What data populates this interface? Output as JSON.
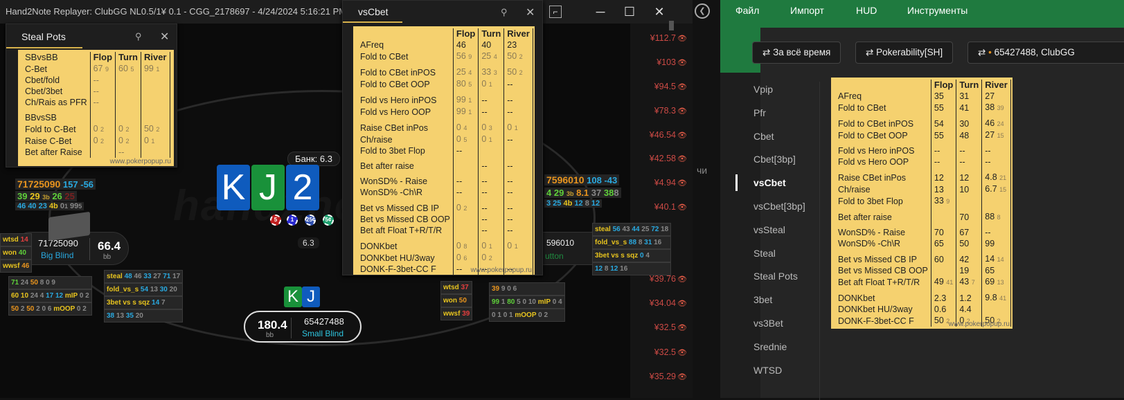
{
  "replayer": {
    "title": "Hand2Note Replayer: ClubGG NL0.5/1¥ 0.1 - CGG_2178697 - 4/24/2024 5:16:21 PM - 6",
    "pot_label": "Банк: 6.3",
    "pot_amount": "6.3",
    "watermark": "hand2note",
    "board": [
      "K",
      "J",
      "2"
    ],
    "hero_cards": [
      "K",
      "J"
    ],
    "chips": [
      "5",
      "1",
      "25¢",
      "5¢"
    ],
    "side_text": "чи",
    "amounts": [
      "¥112.7",
      "¥103",
      "¥94.5",
      "¥78.3",
      "¥46.54",
      "¥42.58",
      "¥4.94",
      "¥40.1",
      "¥39.76",
      "¥34.04",
      "¥32.5",
      "¥32.5",
      "¥35.29"
    ],
    "seat_bb": {
      "name": "71725090",
      "pos": "Big Blind",
      "stack": "66.4",
      "unit": "bb"
    },
    "seat_sb": {
      "name": "65427488",
      "pos": "Small Blind",
      "stack": "180.4",
      "unit": "bb"
    },
    "seat_btn": {
      "name": "596010",
      "pos": "utton"
    },
    "hud_bb": {
      "line1": [
        "71725090",
        "157",
        "-56"
      ],
      "line2": [
        "39",
        "29",
        "3b",
        "26",
        "25"
      ],
      "line3": [
        "46",
        "40",
        "23",
        "4b",
        "0",
        "1",
        "99",
        "5"
      ],
      "side": [
        [
          "wtsd",
          "14"
        ],
        [
          "won",
          "40"
        ],
        [
          "wwsf",
          "46"
        ]
      ],
      "stats1": [
        "71",
        "24",
        "50",
        "8",
        "0",
        "9"
      ],
      "stats2": [
        "60",
        "10",
        "24",
        "4",
        "17",
        "12",
        "mIP",
        "0",
        "2"
      ],
      "stats3": [
        "50",
        "2",
        "50",
        "2",
        "0",
        "6",
        "mOOP",
        "0",
        "2"
      ],
      "steal": [
        "steal",
        "48",
        "46",
        "33",
        "27",
        "71",
        "17"
      ],
      "fold": [
        "fold_vs_s",
        "54",
        "13",
        "30",
        "20"
      ],
      "tbet": [
        "3bet vs s",
        "sqz",
        "14",
        "7"
      ],
      "last": [
        "38",
        "13",
        "35",
        "20"
      ]
    },
    "hud_btn": {
      "line1": [
        "7596010",
        "108",
        "-43"
      ],
      "line2": [
        "4",
        "29",
        "3b",
        "8.1",
        "37",
        "38",
        "8"
      ],
      "line3": [
        "3",
        "25",
        "4b",
        "12",
        "8",
        "12"
      ],
      "steal": [
        "steal",
        "56",
        "43",
        "44",
        "25",
        "72",
        "18"
      ],
      "fold": [
        "fold_vs_s",
        "88",
        "8",
        "31",
        "16"
      ],
      "tbet": [
        "3bet vs s",
        "sqz",
        "0",
        "4"
      ],
      "last": [
        "12",
        "8",
        "12",
        "16"
      ],
      "side": [
        [
          "wtsd",
          "37"
        ],
        [
          "won",
          "50"
        ],
        [
          "wwsf",
          "39"
        ]
      ],
      "stats1": [
        "39",
        "9",
        "0",
        "6"
      ],
      "stats2": [
        "99",
        "1",
        "80",
        "5",
        "0",
        "10",
        "mIP",
        "0",
        "4"
      ],
      "stats3": [
        "0",
        "1",
        "0",
        "1",
        "mOOP",
        "0",
        "2"
      ]
    }
  },
  "steal_pots": {
    "title": "Steal Pots",
    "headers": [
      "SBvsBB",
      "Flop",
      "Turn",
      "River"
    ],
    "rows1": [
      {
        "label": "C-Bet",
        "flop": "67",
        "flop_n": "9",
        "turn": "60",
        "turn_n": "5",
        "river": "99",
        "river_n": "1"
      },
      {
        "label": "Cbet/fold",
        "flop": "--",
        "flop_n": "",
        "turn": "",
        "turn_n": "",
        "river": "",
        "river_n": ""
      },
      {
        "label": "Cbet/3bet",
        "flop": "--",
        "flop_n": "",
        "turn": "",
        "turn_n": "",
        "river": "",
        "river_n": ""
      },
      {
        "label": "Ch/Rais as PFR",
        "flop": "--",
        "flop_n": "",
        "turn": "",
        "turn_n": "",
        "river": "",
        "river_n": ""
      }
    ],
    "header2": "BBvsSB",
    "rows2": [
      {
        "label": "Fold to C-Bet",
        "flop": "0",
        "flop_n": "2",
        "turn": "0",
        "turn_n": "2",
        "river": "50",
        "river_n": "2"
      },
      {
        "label": "Raise C-Bet",
        "flop": "0",
        "flop_n": "2",
        "turn": "0",
        "turn_n": "2",
        "river": "0",
        "river_n": "1"
      },
      {
        "label": "Bet after Raise",
        "flop": "",
        "flop_n": "",
        "turn": "--",
        "turn_n": "",
        "river": "",
        "river_n": ""
      }
    ],
    "footer": "www.pokerpopup.ru"
  },
  "vscbet_popup": {
    "title": "vsCbet",
    "headers": [
      "",
      "Flop",
      "Turn",
      "River"
    ],
    "groups": [
      [
        {
          "label": "AFreq",
          "v": [
            "46",
            "",
            "40",
            "",
            "23",
            ""
          ]
        },
        {
          "label": "Fold to CBet",
          "v": [
            "56",
            "9",
            "25",
            "4",
            "50",
            "2"
          ]
        }
      ],
      [
        {
          "label": "Fold to CBet inPOS",
          "v": [
            "25",
            "4",
            "33",
            "3",
            "50",
            "2"
          ]
        },
        {
          "label": "Fold to CBet OOP",
          "v": [
            "80",
            "5",
            "0",
            "1",
            "--",
            ""
          ]
        }
      ],
      [
        {
          "label": "Fold vs Hero inPOS",
          "v": [
            "99",
            "1",
            "--",
            "",
            "--",
            ""
          ]
        },
        {
          "label": "Fold vs Hero OOP",
          "v": [
            "99",
            "1",
            "--",
            "",
            "--",
            ""
          ]
        }
      ],
      [
        {
          "label": "Raise CBet inPos",
          "v": [
            "0",
            "4",
            "0",
            "3",
            "0",
            "1"
          ]
        },
        {
          "label": "Ch/raise",
          "v": [
            "0",
            "5",
            "0",
            "1",
            "--",
            ""
          ]
        },
        {
          "label": "Fold to 3bet Flop",
          "v": [
            "--",
            "",
            "",
            "",
            "",
            ""
          ]
        }
      ],
      [
        {
          "label": "Bet after raise",
          "v": [
            "",
            "",
            "--",
            "",
            "--",
            ""
          ]
        }
      ],
      [
        {
          "label": "WonSD% - Raise",
          "v": [
            "--",
            "",
            "--",
            "",
            "--",
            ""
          ]
        },
        {
          "label": "WonSD% -Ch\\R",
          "v": [
            "--",
            "",
            "--",
            "",
            "--",
            ""
          ]
        }
      ],
      [
        {
          "label": "Bet vs Missed CB IP",
          "v": [
            "0",
            "2",
            "--",
            "",
            "--",
            ""
          ]
        },
        {
          "label": "Bet vs Missed CB OOP",
          "v": [
            "",
            "",
            "--",
            "",
            "--",
            ""
          ]
        },
        {
          "label": "Bet aft Float T+R/T/R",
          "v": [
            "",
            "",
            "--",
            "",
            "--",
            ""
          ]
        }
      ],
      [
        {
          "label": "DONKbet",
          "v": [
            "0",
            "8",
            "0",
            "1",
            "0",
            "1"
          ]
        },
        {
          "label": "DONKbet HU/3way",
          "v": [
            "0",
            "6",
            "0",
            "2",
            "",
            ""
          ]
        },
        {
          "label": "DONK-F-3bet-CC F",
          "v": [
            "--",
            "",
            "--",
            "",
            "--",
            ""
          ]
        }
      ]
    ],
    "footer": "www.pokerpopup.ru"
  },
  "app": {
    "menu": [
      "Файл",
      "Импорт",
      "HUD",
      "Инструменты"
    ],
    "filters": [
      "За всё время",
      "Pokerability[SH]",
      "65427488, ClubGG"
    ],
    "nav": [
      "Vpip",
      "Pfr",
      "Cbet",
      "Cbet[3bp]",
      "vsCbet",
      "vsCbet[3bp]",
      "vsSteal",
      "Steal",
      "Steal Pots",
      "3bet",
      "vs3Bet",
      "Srednie",
      "WTSD"
    ],
    "active_nav": "vsCbet",
    "stats": {
      "headers": [
        "",
        "Flop",
        "Turn",
        "River"
      ],
      "groups": [
        [
          {
            "label": "AFreq",
            "v": [
              "35",
              "",
              "31",
              "",
              "27",
              ""
            ]
          },
          {
            "label": "Fold to CBet",
            "v": [
              "55",
              "",
              "41",
              "",
              "38",
              "39"
            ]
          }
        ],
        [
          {
            "label": "Fold to CBet inPOS",
            "v": [
              "54",
              "",
              "30",
              "",
              "46",
              "24"
            ]
          },
          {
            "label": "Fold to CBet OOP",
            "v": [
              "55",
              "",
              "48",
              "",
              "27",
              "15"
            ]
          }
        ],
        [
          {
            "label": "Fold vs Hero inPOS",
            "v": [
              "--",
              "",
              "--",
              "",
              "--",
              ""
            ]
          },
          {
            "label": "Fold vs Hero OOP",
            "v": [
              "--",
              "",
              "--",
              "",
              "--",
              ""
            ]
          }
        ],
        [
          {
            "label": "Raise CBet inPos",
            "v": [
              "12",
              "",
              "12",
              "",
              "4.8",
              "21"
            ]
          },
          {
            "label": "Ch/raise",
            "v": [
              "13",
              "",
              "10",
              "",
              "6.7",
              "15"
            ]
          },
          {
            "label": "Fold to 3bet Flop",
            "v": [
              "33",
              "9",
              "",
              "",
              "",
              ""
            ]
          }
        ],
        [
          {
            "label": "Bet after raise",
            "v": [
              "",
              "",
              "70",
              "",
              "88",
              "8"
            ]
          }
        ],
        [
          {
            "label": "WonSD% - Raise",
            "v": [
              "70",
              "",
              "67",
              "",
              "--",
              ""
            ]
          },
          {
            "label": "WonSD% -Ch\\R",
            "v": [
              "65",
              "",
              "50",
              "",
              "99",
              ""
            ]
          }
        ],
        [
          {
            "label": "Bet vs Missed CB IP",
            "v": [
              "60",
              "",
              "42",
              "",
              "14",
              "14"
            ]
          },
          {
            "label": "Bet vs Missed CB OOP",
            "v": [
              "",
              "",
              "19",
              "",
              "65",
              ""
            ]
          },
          {
            "label": "Bet aft Float T+R/T/R",
            "v": [
              "49",
              "41",
              "43",
              "7",
              "69",
              "13"
            ]
          }
        ],
        [
          {
            "label": "DONKbet",
            "v": [
              "2.3",
              "",
              "1.2",
              "",
              "9.8",
              "41"
            ]
          },
          {
            "label": "DONKbet HU/3way",
            "v": [
              "0.6",
              "",
              "4.4",
              "",
              "",
              ""
            ]
          },
          {
            "label": "DONK-F-3bet-CC F",
            "v": [
              "50",
              "2",
              "0",
              "2",
              "50",
              "2"
            ]
          }
        ]
      ],
      "footer": "www.pokerpopup.ru"
    }
  }
}
